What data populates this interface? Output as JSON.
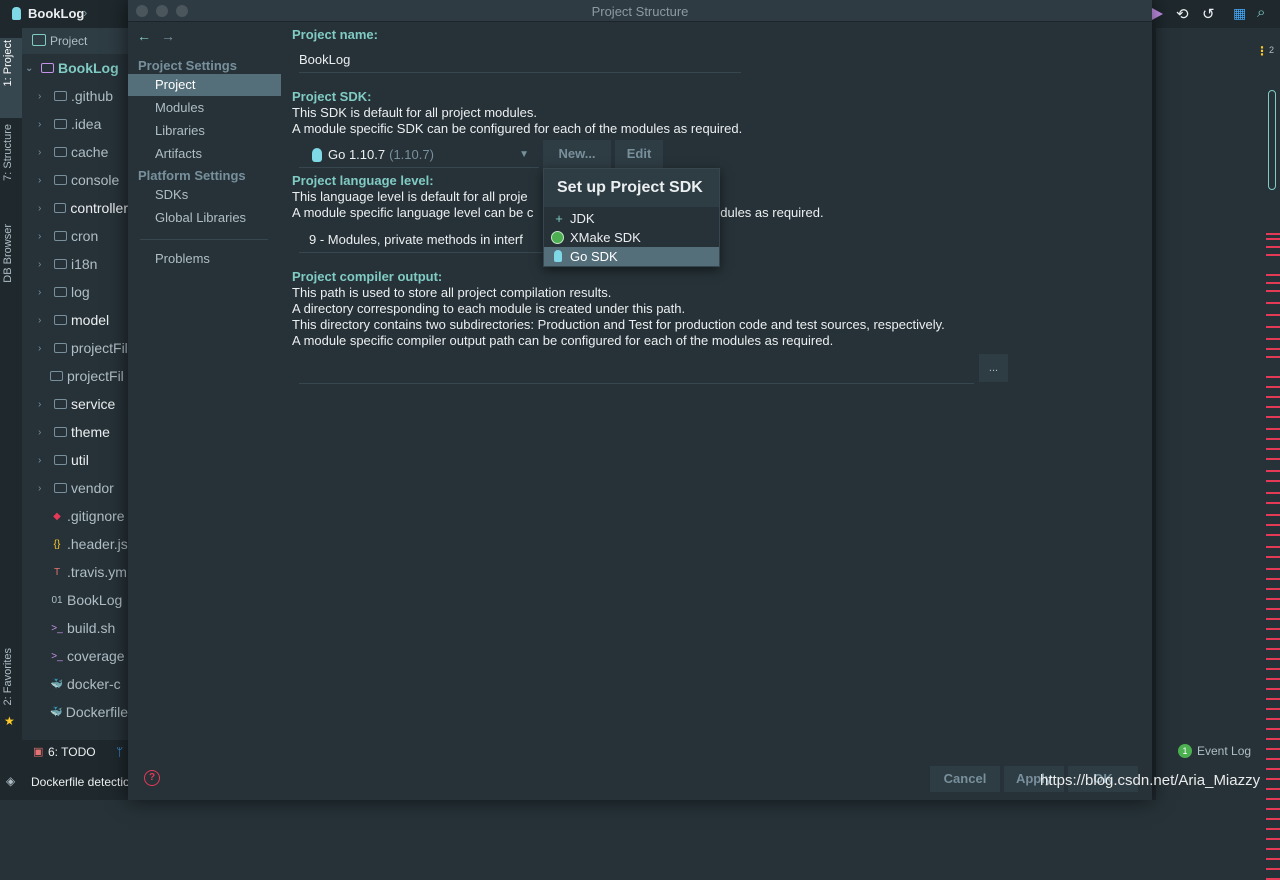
{
  "ide": {
    "project_title": "BookLog",
    "breadcrumb_sep": "›",
    "panel_label": "Project",
    "root_label": "BookLog",
    "left_tabs": [
      "1: Project",
      "7: Structure",
      "DB Browser",
      "2: Favorites"
    ],
    "tree": [
      {
        "label": ".github",
        "type": "folder"
      },
      {
        "label": ".idea",
        "type": "folder"
      },
      {
        "label": "cache",
        "type": "folder"
      },
      {
        "label": "console",
        "type": "folder"
      },
      {
        "label": "controller",
        "type": "folder",
        "bright": true
      },
      {
        "label": "cron",
        "type": "folder"
      },
      {
        "label": "i18n",
        "type": "folder"
      },
      {
        "label": "log",
        "type": "folder"
      },
      {
        "label": "model",
        "type": "folder",
        "bright": true
      },
      {
        "label": "projectFil",
        "type": "folder"
      },
      {
        "label": "projectFil",
        "type": "folder-noexpand"
      },
      {
        "label": "service",
        "type": "folder",
        "bright": true
      },
      {
        "label": "theme",
        "type": "folder",
        "bright": true
      },
      {
        "label": "util",
        "type": "folder",
        "bright": true
      },
      {
        "label": "vendor",
        "type": "folder"
      },
      {
        "label": ".gitignore",
        "type": "file",
        "icon": "◆"
      },
      {
        "label": ".header.js",
        "type": "file",
        "icon": "{}"
      },
      {
        "label": ".travis.ym",
        "type": "file",
        "icon": "T"
      },
      {
        "label": "BookLog",
        "type": "file",
        "icon": "01"
      },
      {
        "label": "build.sh",
        "type": "file",
        "icon": ">_"
      },
      {
        "label": "coverage",
        "type": "file",
        "icon": ">_"
      },
      {
        "label": "docker-c",
        "type": "file",
        "icon": "🐳"
      },
      {
        "label": "Dockerfile",
        "type": "file",
        "icon": "🐳"
      }
    ],
    "todo_tab": "6: TODO",
    "status_text": "Dockerfile detectio",
    "event_log": "Event Log",
    "event_count": "1",
    "right_badge": "2",
    "watermark": "https://blog.csdn.net/Aria_Miazzy",
    "colors": {
      "accent": "#80cbc4",
      "selection": "#546e7a",
      "error_mark": "#e53958",
      "background": "#263238"
    }
  },
  "dialog": {
    "title": "Project Structure",
    "nav": {
      "back": "←",
      "forward": "→",
      "project_settings": "Project Settings",
      "platform_settings": "Platform Settings",
      "items_project": [
        "Project",
        "Modules",
        "Libraries",
        "Artifacts"
      ],
      "items_platform": [
        "SDKs",
        "Global Libraries"
      ],
      "problems": "Problems",
      "selected": "Project"
    },
    "project_name": {
      "heading": "Project name:",
      "value": "BookLog"
    },
    "project_sdk": {
      "heading": "Project SDK:",
      "line1": "This SDK is default for all project modules.",
      "line2": "A module specific SDK can be configured for each of the modules as required.",
      "selected": "Go 1.10.7",
      "selected_detail": "(1.10.7)",
      "new_label": "New...",
      "edit_label": "Edit"
    },
    "language_level": {
      "heading": "Project language level:",
      "line1": "This language level is default for all proje",
      "line2a": "A module specific language level can be c",
      "line2b": "odules as required.",
      "selected": "9 - Modules, private methods in interf"
    },
    "compiler_output": {
      "heading": "Project compiler output:",
      "line1": "This path is used to store all project compilation results.",
      "line2": "A directory corresponding to each module is created under this path.",
      "line3": "This directory contains two subdirectories: Production and Test for production code and test sources, respectively.",
      "line4": "A module specific compiler output path can be configured for each of the modules as required.",
      "value": "",
      "browse_label": "..."
    },
    "popup": {
      "title": "Set up Project SDK",
      "items": [
        {
          "label": "JDK",
          "icon": "plus-icon"
        },
        {
          "label": "XMake SDK",
          "icon": "xmake-icon"
        },
        {
          "label": "Go SDK",
          "icon": "gopher-icon",
          "selected": true
        }
      ]
    },
    "buttons": {
      "help": "?",
      "cancel": "Cancel",
      "apply": "Apply",
      "ok": "OK"
    }
  }
}
